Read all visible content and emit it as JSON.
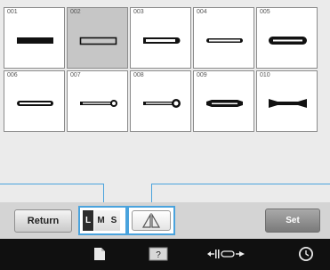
{
  "patterns": [
    {
      "number": "001",
      "selected": false,
      "shape": "bar-filled"
    },
    {
      "number": "002",
      "selected": true,
      "shape": "bar-outline"
    },
    {
      "number": "003",
      "selected": false,
      "shape": "rounded-right"
    },
    {
      "number": "004",
      "selected": false,
      "shape": "rounded-both-thin"
    },
    {
      "number": "005",
      "selected": false,
      "shape": "rounded-both-thick"
    },
    {
      "number": "006",
      "selected": false,
      "shape": "oval-thin"
    },
    {
      "number": "007",
      "selected": false,
      "shape": "keyhole-small"
    },
    {
      "number": "008",
      "selected": false,
      "shape": "keyhole-large"
    },
    {
      "number": "009",
      "selected": false,
      "shape": "tapered-bar"
    },
    {
      "number": "010",
      "selected": false,
      "shape": "bowtie-bar"
    }
  ],
  "buttons": {
    "return_label": "Return",
    "set_label": "Set",
    "size_large": "L",
    "size_medium": "M",
    "size_small": "S",
    "size_selected": "L",
    "mirror_icon": "mirror-icon"
  },
  "toolbar": {
    "items": [
      "page-icon",
      "help-icon",
      "width-icon",
      "clock-icon"
    ]
  },
  "colors": {
    "highlight": "#4aa3dd",
    "tile_selected": "#c6c6c6",
    "toolbar_bg": "#101010"
  }
}
